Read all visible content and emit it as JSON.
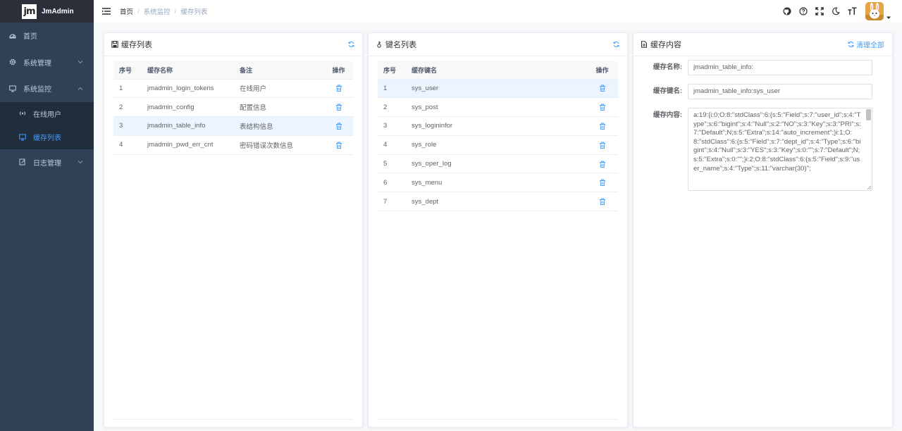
{
  "app": {
    "logo_mark": "jm",
    "name": "JmAdmin"
  },
  "sidebar": {
    "home": "首页",
    "system_manage": "系统管理",
    "system_monitor": "系统监控",
    "online_users": "在线用户",
    "cache_list": "缓存列表",
    "log_manage": "日志管理"
  },
  "breadcrumb": [
    "首页",
    "系统监控",
    "缓存列表"
  ],
  "colors": {
    "sidebar_bg": "#304156",
    "sub_bg": "#1f2d3d",
    "accent": "#409eff",
    "active_row": "#ecf5ff"
  },
  "cache_panel": {
    "title": "缓存列表",
    "columns": [
      "序号",
      "缓存名称",
      "备注",
      "操作"
    ],
    "rows": [
      {
        "no": "1",
        "name": "jmadmin_login_tokens",
        "remark": "在线用户"
      },
      {
        "no": "2",
        "name": "jmadmin_config",
        "remark": "配置信息"
      },
      {
        "no": "3",
        "name": "jmadmin_table_info",
        "remark": "表结构信息"
      },
      {
        "no": "4",
        "name": "jmadmin_pwd_err_cnt",
        "remark": "密码错误次数信息"
      }
    ]
  },
  "keys_panel": {
    "title": "键名列表",
    "columns": [
      "序号",
      "缓存键名",
      "操作"
    ],
    "rows": [
      {
        "no": "1",
        "key": "sys_user"
      },
      {
        "no": "2",
        "key": "sys_post"
      },
      {
        "no": "3",
        "key": "sys_logininfor"
      },
      {
        "no": "4",
        "key": "sys_role"
      },
      {
        "no": "5",
        "key": "sys_oper_log"
      },
      {
        "no": "6",
        "key": "sys_menu"
      },
      {
        "no": "7",
        "key": "sys_dept"
      }
    ]
  },
  "content_panel": {
    "title": "缓存内容",
    "clear_all": "清理全部",
    "name_label": "缓存名称:",
    "name_value": "jmadmin_table_info:",
    "key_label": "缓存键名:",
    "key_value": "jmadmin_table_info:sys_user",
    "content_label": "缓存内容:",
    "content_value": "a:19:{i:0;O:8:\"stdClass\":6:{s:5:\"Field\";s:7:\"user_id\";s:4:\"Type\";s:6:\"bigint\";s:4:\"Null\";s:2:\"NO\";s:3:\"Key\";s:3:\"PRI\";s:7:\"Default\";N;s:5:\"Extra\";s:14:\"auto_increment\";}i:1;O:8:\"stdClass\":6:{s:5:\"Field\";s:7:\"dept_id\";s:4:\"Type\";s:6:\"bigint\";s:4:\"Null\";s:3:\"YES\";s:3:\"Key\";s:0:\"\";s:7:\"Default\";N;s:5:\"Extra\";s:0:\"\";}i:2;O:8:\"stdClass\":6:{s:5:\"Field\";s:9:\"user_name\";s:4:\"Type\";s:11:\"varchar(30)\";"
  }
}
